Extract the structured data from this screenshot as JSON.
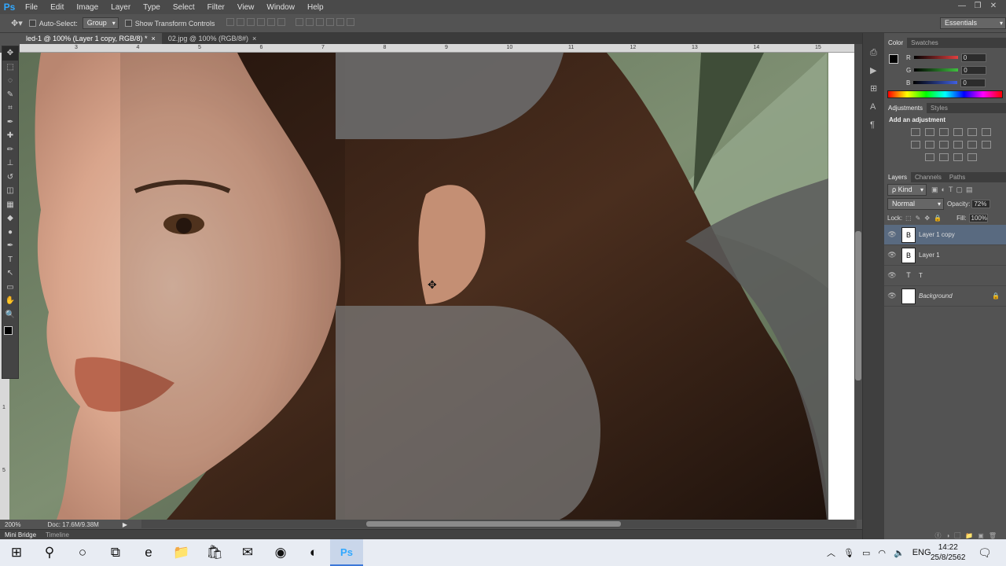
{
  "app": {
    "logo": "Ps",
    "colors": {
      "accent": "#31a8ff",
      "chrome": "#535353",
      "panel_dark": "#3d3d3d"
    }
  },
  "menu": [
    "File",
    "Edit",
    "Image",
    "Layer",
    "Type",
    "Select",
    "Filter",
    "View",
    "Window",
    "Help"
  ],
  "window_controls": {
    "minimize": "—",
    "restore": "❐",
    "close": "✕"
  },
  "options": {
    "auto_select_label": "Auto-Select:",
    "auto_select_value": "Group",
    "show_transform_label": "Show Transform Controls",
    "workspace": "Essentials"
  },
  "tabs": [
    {
      "title": "led-1 @ 100% (Layer 1 copy, RGB/8) *",
      "close": "×",
      "active": true
    },
    {
      "title": "02.jpg @ 100% (RGB/8#)",
      "close": "×",
      "active": false
    }
  ],
  "ruler_top": [
    "3",
    "4",
    "5",
    "6",
    "7",
    "8",
    "9",
    "10",
    "11",
    "12",
    "13",
    "14",
    "15"
  ],
  "ruler_left": [
    "1",
    "5"
  ],
  "tools": [
    "move-tool-icon",
    "marquee-tool-icon",
    "lasso-tool-icon",
    "quick-select-tool-icon",
    "crop-tool-icon",
    "eyedropper-tool-icon",
    "healing-brush-icon",
    "brush-tool-icon",
    "clone-stamp-icon",
    "history-brush-icon",
    "eraser-tool-icon",
    "gradient-tool-icon",
    "blur-tool-icon",
    "dodge-tool-icon",
    "pen-tool-icon",
    "type-tool-icon",
    "path-select-icon",
    "shape-tool-icon",
    "hand-tool-icon",
    "zoom-tool-icon"
  ],
  "tool_glyphs": [
    "✥",
    "⬚",
    "◌",
    "✎",
    "⌗",
    "✒",
    "✚",
    "✏",
    "⊥",
    "↺",
    "◫",
    "▦",
    "◆",
    "●",
    "✒",
    "T",
    "↖",
    "▭",
    "✋",
    "🔍"
  ],
  "status": {
    "zoom": "200%",
    "doc": "Doc: 17.6M/9.38M"
  },
  "bottom_tabs": [
    "Mini Bridge",
    "Timeline"
  ],
  "color_panel": {
    "tabs": [
      "Color",
      "Swatches"
    ],
    "channels": [
      {
        "label": "R",
        "value": "0",
        "color": "#e04040"
      },
      {
        "label": "G",
        "value": "0",
        "color": "#40c040"
      },
      {
        "label": "B",
        "value": "0",
        "color": "#4060e0"
      }
    ]
  },
  "adjustments_panel": {
    "tabs": [
      "Adjustments",
      "Styles"
    ],
    "heading": "Add an adjustment"
  },
  "layers_panel": {
    "tabs": [
      "Layers",
      "Channels",
      "Paths"
    ],
    "kind_label": "ρ Kind",
    "blend_mode": "Normal",
    "opacity_label": "Opacity:",
    "opacity_value": "72%",
    "lock_label": "Lock:",
    "fill_label": "Fill:",
    "fill_value": "100%",
    "layers": [
      {
        "name": "Layer 1 copy",
        "thumb": "B",
        "selected": true
      },
      {
        "name": "Layer 1",
        "thumb": "B",
        "selected": false
      },
      {
        "name": "T",
        "thumb": "T",
        "selected": false
      },
      {
        "name": "Background",
        "thumb": "",
        "selected": false
      }
    ]
  },
  "taskbar": {
    "start": "⊞",
    "search": "⚲",
    "cortana": "○",
    "apps": [
      "task-view-icon",
      "edge-icon",
      "file-explorer-icon",
      "store-icon",
      "mail-icon",
      "chrome-icon",
      "app-icon",
      "photoshop-icon"
    ],
    "app_glyphs": [
      "⧉",
      "e",
      "📁",
      "🛍",
      "✉",
      "◉",
      "◐",
      "Ps"
    ],
    "lang": "ENG",
    "time": "14:22",
    "date": "25/8/2562"
  }
}
